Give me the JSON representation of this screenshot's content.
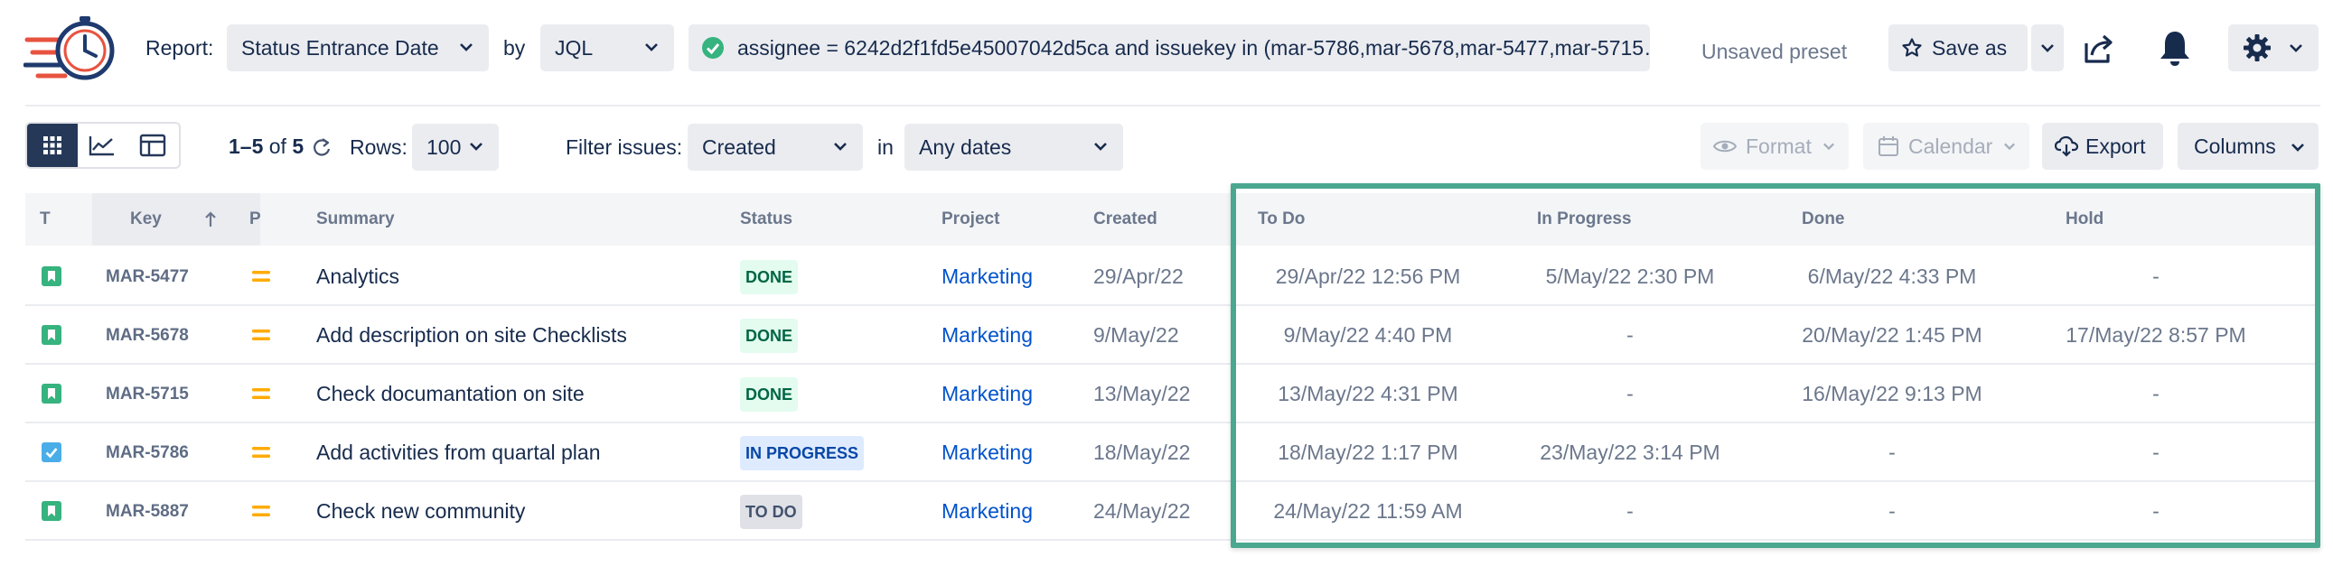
{
  "topbar": {
    "report_label": "Report:",
    "report_value": "Status Entrance Date",
    "by_label": "by",
    "by_value": "JQL",
    "jql_query": "assignee = 6242d2f1fd5e45007042d5ca and issuekey in (mar-5786,mar-5678,mar-5477,mar-5715…",
    "unsaved_label": "Unsaved preset",
    "save_as_label": "Save as",
    "icons": [
      "timer-logo-icon",
      "check-circle-icon",
      "star-icon",
      "chevron-down-icon",
      "share-icon",
      "bell-icon",
      "gear-icon"
    ]
  },
  "toolbar": {
    "count_range": "1–5",
    "count_of": "of",
    "count_total": "5",
    "rows_label": "Rows:",
    "rows_value": "100",
    "filter_label": "Filter issues:",
    "filter_value": "Created",
    "in_label": "in",
    "dates_value": "Any dates",
    "format_label": "Format",
    "calendar_label": "Calendar",
    "export_label": "Export",
    "columns_label": "Columns",
    "view_icons": [
      "grid-view-icon",
      "chart-view-icon",
      "layout-view-icon"
    ]
  },
  "table": {
    "headers": {
      "t": "T",
      "key": "Key",
      "p": "P",
      "summary": "Summary",
      "status": "Status",
      "project": "Project",
      "created": "Created",
      "todo": "To Do",
      "inprogress": "In Progress",
      "done": "Done",
      "hold": "Hold"
    },
    "rows": [
      {
        "type": "story",
        "key": "MAR-5477",
        "summary": "Analytics",
        "status": "DONE",
        "project": "Marketing",
        "created": "29/Apr/22",
        "todo": "29/Apr/22 12:56 PM",
        "inprogress": "5/May/22 2:30 PM",
        "done": "6/May/22 4:33 PM",
        "hold": "-"
      },
      {
        "type": "story",
        "key": "MAR-5678",
        "summary": "Add description on site Checklists",
        "status": "DONE",
        "project": "Marketing",
        "created": "9/May/22",
        "todo": "9/May/22 4:40 PM",
        "inprogress": "-",
        "done": "20/May/22 1:45 PM",
        "hold": "17/May/22 8:57 PM"
      },
      {
        "type": "story",
        "key": "MAR-5715",
        "summary": "Check documantation on site",
        "status": "DONE",
        "project": "Marketing",
        "created": "13/May/22",
        "todo": "13/May/22 4:31 PM",
        "inprogress": "-",
        "done": "16/May/22 9:13 PM",
        "hold": "-"
      },
      {
        "type": "task",
        "key": "MAR-5786",
        "summary": "Add activities from quartal plan",
        "status": "IN PROGRESS",
        "project": "Marketing",
        "created": "18/May/22",
        "todo": "18/May/22 1:17 PM",
        "inprogress": "23/May/22 3:14 PM",
        "done": "-",
        "hold": "-"
      },
      {
        "type": "story",
        "key": "MAR-5887",
        "summary": "Check new community",
        "status": "TO DO",
        "project": "Marketing",
        "created": "24/May/22",
        "todo": "24/May/22 11:59 AM",
        "inprogress": "-",
        "done": "-",
        "hold": "-"
      }
    ]
  },
  "colors": {
    "accent_highlight": "#4aa790",
    "story_icon": "#36b37e",
    "task_icon": "#4bade8",
    "priority_medium": "#ffab00",
    "link": "#0052cc"
  }
}
